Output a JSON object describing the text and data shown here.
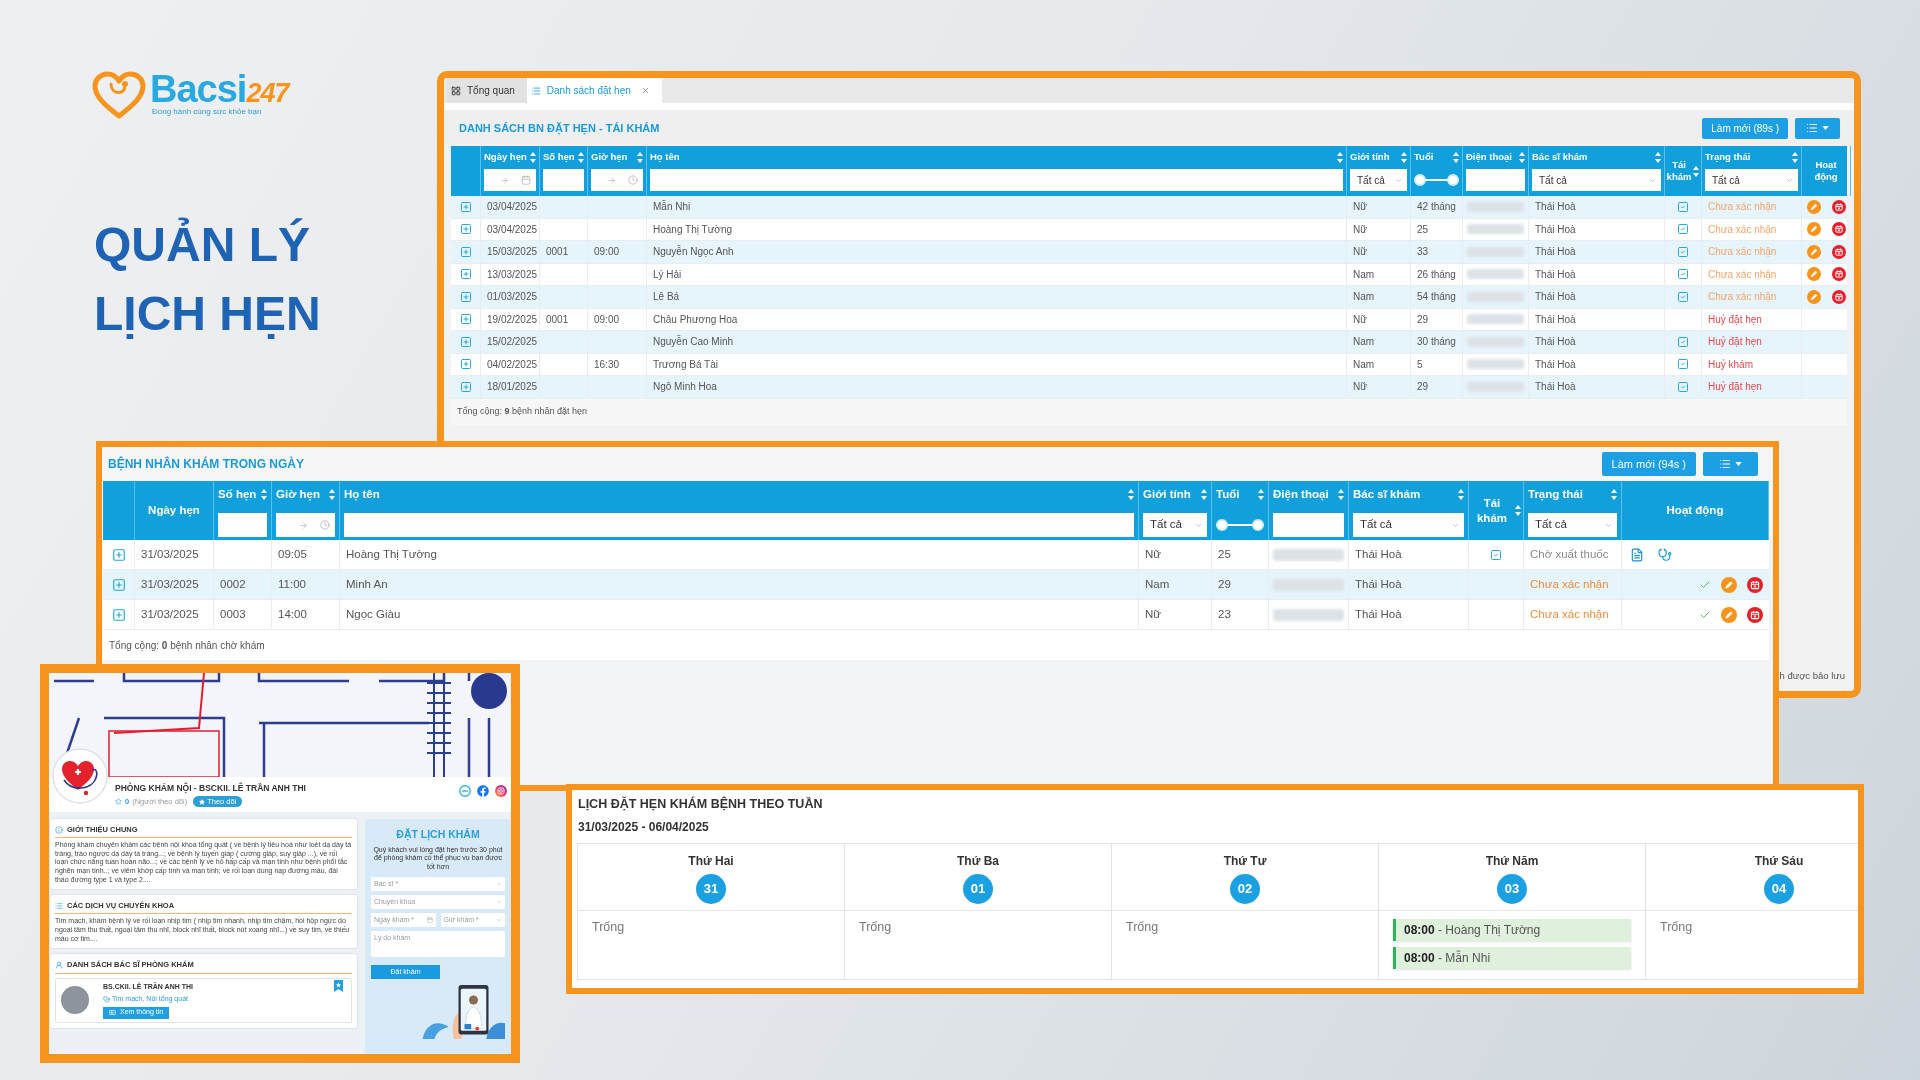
{
  "brand": {
    "name": "Bacsi",
    "suffix": "247",
    "tagline": "Đồng hành cùng sức khỏe bạn"
  },
  "headline": [
    "QUẢN LÝ",
    "LỊCH HẸN"
  ],
  "appointment_list": {
    "tabs": [
      {
        "label": "Tổng quan",
        "selected": false,
        "closable": false
      },
      {
        "label": "Danh sách đặt hẹn",
        "selected": true,
        "closable": true
      }
    ],
    "title": "DANH SÁCH BN ĐẶT HẸN - TÁI KHÁM",
    "refresh_button": "Làm mới (89s )",
    "table": {
      "columns": [
        {
          "label": "Ngày hẹn",
          "sortable": true,
          "filter": {
            "kind": "date_range"
          }
        },
        {
          "label": "Số hẹn",
          "sortable": true,
          "filter": {
            "kind": "text"
          }
        },
        {
          "label": "Giờ hẹn",
          "sortable": true,
          "filter": {
            "kind": "time_range"
          }
        },
        {
          "label": "Họ tên",
          "sortable": true,
          "filter": {
            "kind": "text"
          }
        },
        {
          "label": "Giới tính",
          "sortable": true,
          "filter": {
            "kind": "select",
            "value": "Tất cả"
          }
        },
        {
          "label": "Tuổi",
          "sortable": true,
          "filter": {
            "kind": "range",
            "level": 1
          }
        },
        {
          "label": "Điện thoại",
          "sortable": true,
          "filter": {
            "kind": "text"
          }
        },
        {
          "label": "Bác sĩ khám",
          "sortable": true,
          "filter": {
            "kind": "select",
            "value": "Tất cả"
          }
        },
        {
          "label": "Tái khám",
          "sortable": true
        },
        {
          "label": "Trạng thái",
          "sortable": true,
          "filter": {
            "kind": "select",
            "value": "Tất cả"
          }
        },
        {
          "label": "Hoạt động",
          "sortable": false
        }
      ],
      "rows": [
        {
          "kind": "pending",
          "date": "03/04/2025",
          "name": "Mẫn Nhi",
          "gender": "Nữ",
          "age": "42 tháng",
          "doctor": "Thái Hoà",
          "revisit": true,
          "status": "Chưa xác nhận"
        },
        {
          "kind": "pending",
          "date": "03/04/2025",
          "name": "Hoàng Thị Tường",
          "gender": "Nữ",
          "age": "25",
          "doctor": "Thái Hoà",
          "revisit": true,
          "status": "Chưa xác nhận"
        },
        {
          "kind": "pending",
          "date": "15/03/2025",
          "number": "0001",
          "time": "09:00",
          "name": "Nguyễn Ngọc Anh",
          "gender": "Nữ",
          "age": "33",
          "doctor": "Thái Hoà",
          "revisit": true,
          "status": "Chưa xác nhận"
        },
        {
          "kind": "pending",
          "date": "13/03/2025",
          "name": "Lý Hải",
          "gender": "Nam",
          "age": "26 tháng",
          "doctor": "Thái Hoà",
          "revisit": true,
          "status": "Chưa xác nhận"
        },
        {
          "kind": "pending",
          "date": "01/03/2025",
          "name": "Lê Bá",
          "gender": "Nam",
          "age": "54 tháng",
          "doctor": "Thái Hoà",
          "revisit": true,
          "status": "Chưa xác nhận"
        },
        {
          "kind": "cancelled",
          "date": "19/02/2025",
          "number": "0001",
          "time": "09:00",
          "name": "Châu Phương Hoa",
          "gender": "Nữ",
          "age": "29",
          "doctor": "Thái Hoà",
          "revisit": false,
          "status": "Huỷ đặt hẹn"
        },
        {
          "kind": "cancelled",
          "date": "15/02/2025",
          "name": "Nguyễn Cao Minh",
          "gender": "Nam",
          "age": "30 tháng",
          "doctor": "Thái Hoà",
          "revisit": true,
          "status": "Huỷ đặt hẹn"
        },
        {
          "kind": "cancelled",
          "date": "04/02/2025",
          "time": "16:30",
          "name": "Trương Bá Tài",
          "gender": "Nam",
          "age": "5",
          "doctor": "Thái Hoà",
          "revisit": true,
          "status": "Huỷ khám"
        },
        {
          "kind": "cancelled",
          "date": "18/01/2025",
          "name": "Ngô Minh Hoa",
          "gender": "Nữ",
          "age": "29",
          "doctor": "Thái Hoà",
          "revisit": true,
          "status": "Huỷ đặt hẹn"
        }
      ],
      "footer": "Tổng cộng: **9** bệnh nhân đặt hẹn"
    },
    "note": "h được bảo lưu"
  },
  "today_patients": {
    "title": "BỆNH NHÂN KHÁM TRONG NGÀY",
    "refresh_button": "Làm mới (94s )",
    "table": {
      "columns": [
        {
          "label": "Ngày hẹn",
          "sortable": false
        },
        {
          "label": "Số hẹn",
          "sortable": true,
          "filter": {
            "kind": "text"
          }
        },
        {
          "label": "Giờ hẹn",
          "sortable": true,
          "filter": {
            "kind": "time_range"
          }
        },
        {
          "label": "Họ tên",
          "sortable": true,
          "filter": {
            "kind": "text"
          }
        },
        {
          "label": "Giới tính",
          "sortable": true,
          "filter": {
            "kind": "select",
            "value": "Tất cả"
          }
        },
        {
          "label": "Tuổi",
          "sortable": true,
          "filter": {
            "kind": "range",
            "level": 1
          }
        },
        {
          "label": "Điện thoại",
          "sortable": true,
          "filter": {
            "kind": "text"
          }
        },
        {
          "label": "Bác sĩ khám",
          "sortable": true,
          "filter": {
            "kind": "select",
            "value": "Tất cả"
          }
        },
        {
          "label": "Tái khám",
          "sortable": true
        },
        {
          "label": "Trạng thái",
          "sortable": true,
          "filter": {
            "kind": "select",
            "value": "Tất cả"
          }
        },
        {
          "label": "Hoạt động",
          "sortable": false
        }
      ],
      "rows": [
        {
          "kind": "dispensing",
          "date": "31/03/2025",
          "time": "09:05",
          "name": "Hoàng Thị Tường",
          "gender": "Nữ",
          "age": "25",
          "doctor": "Thái Hoà",
          "revisit": true,
          "status": "Chờ xuất thuốc"
        },
        {
          "kind": "pending",
          "date": "31/03/2025",
          "number": "0002",
          "time": "11:00",
          "name": "Minh An",
          "gender": "Nam",
          "age": "29",
          "doctor": "Thái Hoà",
          "revisit": false,
          "status": "Chưa xác nhận"
        },
        {
          "kind": "pending",
          "date": "31/03/2025",
          "number": "0003",
          "time": "14:00",
          "name": "Ngọc Giàu",
          "gender": "Nữ",
          "age": "23",
          "doctor": "Thái Hoà",
          "revisit": false,
          "status": "Chưa xác nhận"
        }
      ],
      "footer": "Tổng cộng: **0** bệnh nhân chờ khám"
    }
  },
  "clinic_page": {
    "name": "PHÒNG KHÁM NỘI - BSCKII. LÊ TRẦN ANH THI",
    "followers": "0",
    "followers_label": "(Người theo dõi)",
    "follow_button": "Theo dõi",
    "sections": [
      {
        "kind": "intro",
        "title": "GIỚI THIỆU CHUNG",
        "text": "Phòng khám chuyên khám các bệnh nội khoa tổng quát ( về bệnh lý tiêu hoá như loét dạ dày tá tràng, trào ngược dạ dày tá tràng...; về bệnh lý tuyến giáp ( cường giáp, suy giáp ...), về rối loạn chức năng tuần hoàn não...; về các bệnh lý về hô hấp cấp và mạn tính như bệnh phổi tắc nghẽn mạn tính..; về viêm khớp cấp tính và mạn tính; về rối loạn dung nạp đường máu, đái tháo đường type 1 và type 2...."
      },
      {
        "kind": "services",
        "title": "CÁC DỊCH VỤ CHUYÊN KHOA",
        "text": "Tim mạch, khám bệnh lý về rối loạn nhịp tim ( nhịp tim nhanh, nhịp tim chậm, hồi hộp ngực do ngoại tâm thu thất, ngoại tâm thu nhĩ, block nhĩ thất, block nút xoang nhĩ...) về suy tim, về thiếu máu cơ tim...."
      },
      {
        "kind": "doctors",
        "title": "DANH SÁCH BÁC SĨ PHÒNG KHÁM",
        "doctors": [
          {
            "name": "BS.CKII. LÊ TRẦN ANH THI",
            "specialty": "Tim mạch, Nội tổng quát",
            "button": "Xem thông tin"
          }
        ]
      }
    ],
    "booking": {
      "title": "ĐẶT LỊCH KHÁM",
      "note": "Quý khách vui lòng đặt hẹn trước 30 phút để phòng khám có thể phục vụ bạn được tốt hơn",
      "fields": [
        {
          "kind": "select",
          "placeholder": "Bác sĩ *"
        },
        {
          "kind": "select",
          "placeholder": "Chuyên khoa"
        },
        {
          "kind": "date",
          "placeholder": "Ngày khám *"
        },
        {
          "kind": "time",
          "placeholder": "Giờ khám *"
        },
        {
          "kind": "textarea",
          "placeholder": "Lý do khám"
        }
      ],
      "submit": "Đặt khám"
    }
  },
  "week_calendar": {
    "title": "LỊCH ĐẶT HẸN KHÁM BỆNH THEO TUẦN",
    "range": "31/03/2025 - 06/04/2025",
    "days": [
      {
        "name": "Thứ Hai",
        "date": "31",
        "entries": [
          {
            "kind": "empty",
            "text": "Trống"
          }
        ]
      },
      {
        "name": "Thứ Ba",
        "date": "01",
        "entries": [
          {
            "kind": "empty",
            "text": "Trống"
          }
        ]
      },
      {
        "name": "Thứ Tư",
        "date": "02",
        "entries": [
          {
            "kind": "empty",
            "text": "Trống"
          }
        ]
      },
      {
        "name": "Thứ Năm",
        "date": "03",
        "entries": [
          {
            "kind": "event",
            "text": "**08:00** - Hoàng Thị Tường"
          },
          {
            "kind": "event",
            "text": "**08:00** - Mẫn Nhi"
          }
        ]
      },
      {
        "name": "Thứ Sáu",
        "date": "04",
        "entries": [
          {
            "kind": "empty",
            "text": "Trống"
          }
        ]
      }
    ]
  }
}
